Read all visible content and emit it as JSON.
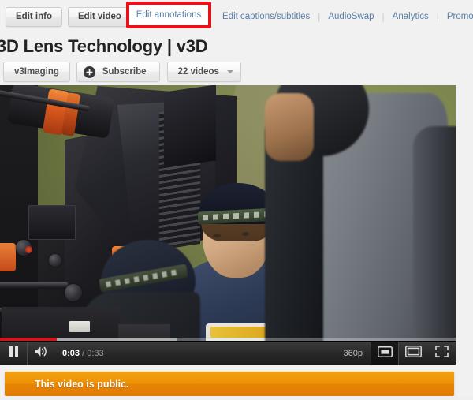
{
  "tabs": {
    "buttons": [
      {
        "label": "Edit info",
        "name": "edit-info"
      },
      {
        "label": "Edit video",
        "name": "edit-video"
      }
    ],
    "active_link": "Edit annotations",
    "links": [
      {
        "label": "Edit captions/subtitles"
      },
      {
        "label": "AudioSwap"
      },
      {
        "label": "Analytics"
      },
      {
        "label": "Promote"
      }
    ],
    "separator": "|",
    "highlight_color": "#e8131a"
  },
  "video": {
    "title": "3D Lens Technology | v3D",
    "channel": "v3Imaging",
    "subscribe_label": "Subscribe",
    "subscribe_icon": "plus-icon",
    "videos_count_label": "22 videos",
    "videos_dropdown_icon": "chevron-down-icon"
  },
  "player": {
    "play_state_icon": "pause-icon",
    "volume_icon": "volume-on-icon",
    "current_time": "0:03",
    "time_separator": " / ",
    "total_time": "0:33",
    "quality_label": "360p",
    "size_small_icon": "small-player-icon",
    "size_large_icon": "large-player-icon",
    "fullscreen_icon": "fullscreen-icon",
    "progress_played_percent": 12.5,
    "progress_buffered_percent": 39,
    "progress_color": "#cc181e"
  },
  "banner": {
    "text": "This video is public.",
    "color": "#ef9207"
  }
}
